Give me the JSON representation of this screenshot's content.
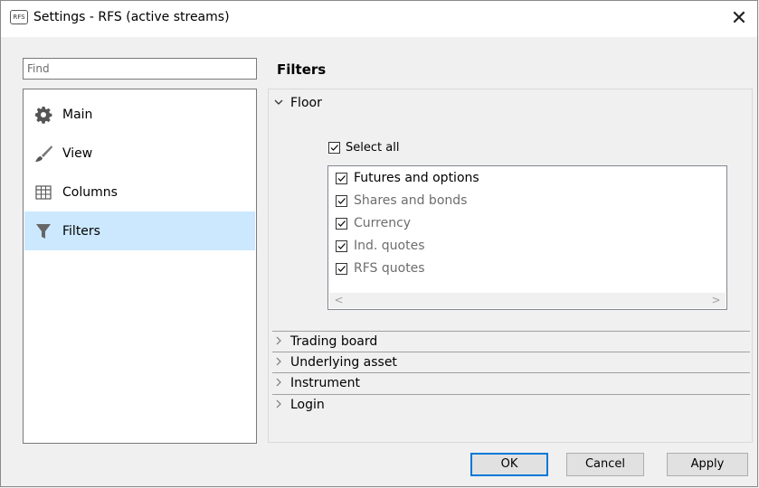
{
  "window": {
    "title": "Settings - RFS (active streams)",
    "app_icon_text": "RFS",
    "close_glyph": "✕"
  },
  "search": {
    "placeholder": "Find",
    "value": ""
  },
  "nav": {
    "items": [
      {
        "label": "Main",
        "icon": "gear-icon",
        "selected": false
      },
      {
        "label": "View",
        "icon": "brush-icon",
        "selected": false
      },
      {
        "label": "Columns",
        "icon": "table-icon",
        "selected": false
      },
      {
        "label": "Filters",
        "icon": "funnel-icon",
        "selected": true
      }
    ]
  },
  "panel": {
    "title": "Filters",
    "sections": [
      {
        "label": "Floor",
        "expanded": true
      },
      {
        "label": "Trading board",
        "expanded": false
      },
      {
        "label": "Underlying asset",
        "expanded": false
      },
      {
        "label": "Instrument",
        "expanded": false
      },
      {
        "label": "Login",
        "expanded": false
      }
    ],
    "floor": {
      "select_all": {
        "label": "Select all",
        "checked": true
      },
      "items": [
        {
          "label": "Futures and options",
          "checked": true
        },
        {
          "label": "Shares and bonds",
          "checked": true
        },
        {
          "label": "Currency",
          "checked": true
        },
        {
          "label": "Ind. quotes",
          "checked": true
        },
        {
          "label": "RFS quotes",
          "checked": true
        }
      ],
      "scroll_left": "<",
      "scroll_right": ">"
    }
  },
  "buttons": {
    "ok": "OK",
    "cancel": "Cancel",
    "apply": "Apply"
  },
  "colors": {
    "selection": "#cce8ff",
    "accent": "#0078d7"
  }
}
